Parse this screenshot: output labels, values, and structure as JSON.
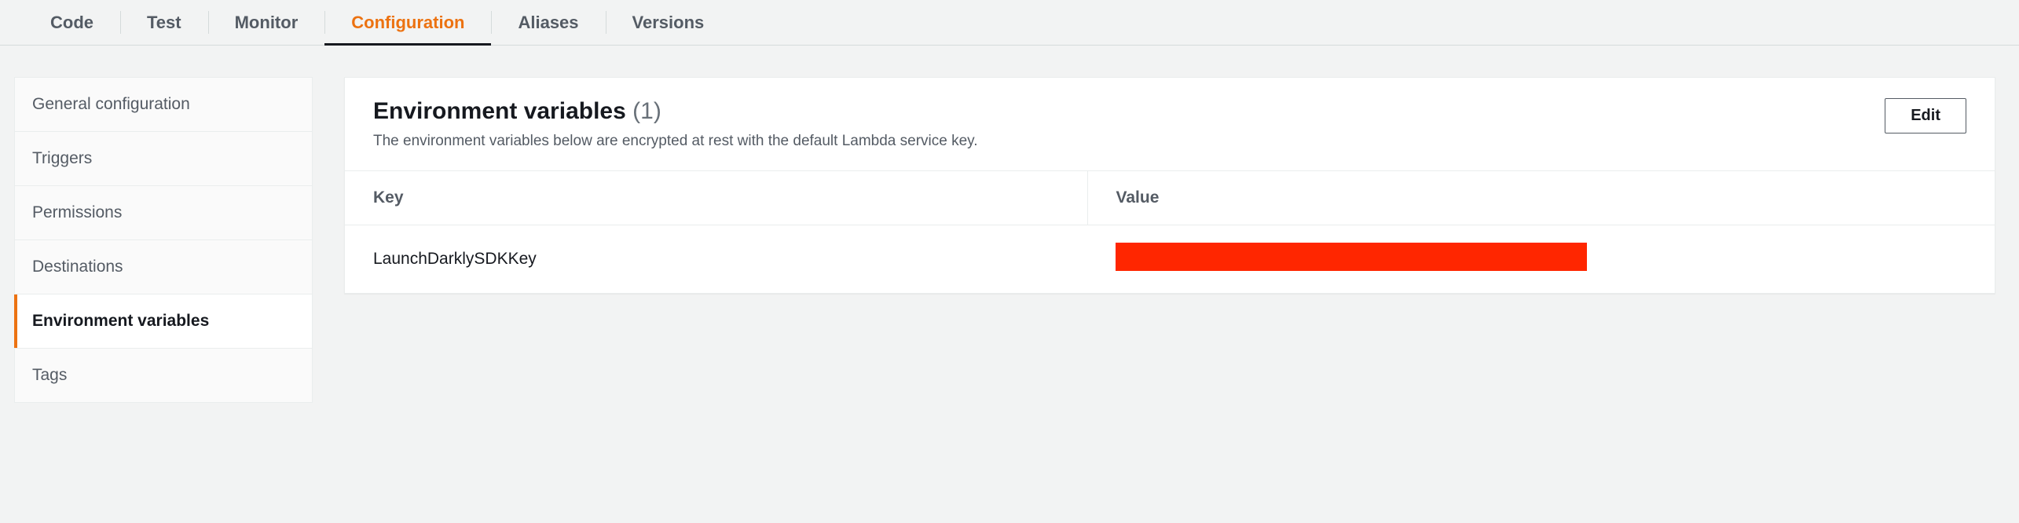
{
  "tabs": [
    {
      "label": "Code"
    },
    {
      "label": "Test"
    },
    {
      "label": "Monitor"
    },
    {
      "label": "Configuration",
      "active": true
    },
    {
      "label": "Aliases"
    },
    {
      "label": "Versions"
    }
  ],
  "sidebar": {
    "items": [
      {
        "label": "General configuration"
      },
      {
        "label": "Triggers"
      },
      {
        "label": "Permissions"
      },
      {
        "label": "Destinations"
      },
      {
        "label": "Environment variables",
        "active": true
      },
      {
        "label": "Tags"
      }
    ]
  },
  "panel": {
    "title": "Environment variables",
    "count": "(1)",
    "subtitle": "The environment variables below are encrypted at rest with the default Lambda service key.",
    "edit_label": "Edit",
    "columns": {
      "key": "Key",
      "value": "Value"
    },
    "rows": [
      {
        "key": "LaunchDarklySDKKey",
        "value_redacted": true
      }
    ]
  }
}
